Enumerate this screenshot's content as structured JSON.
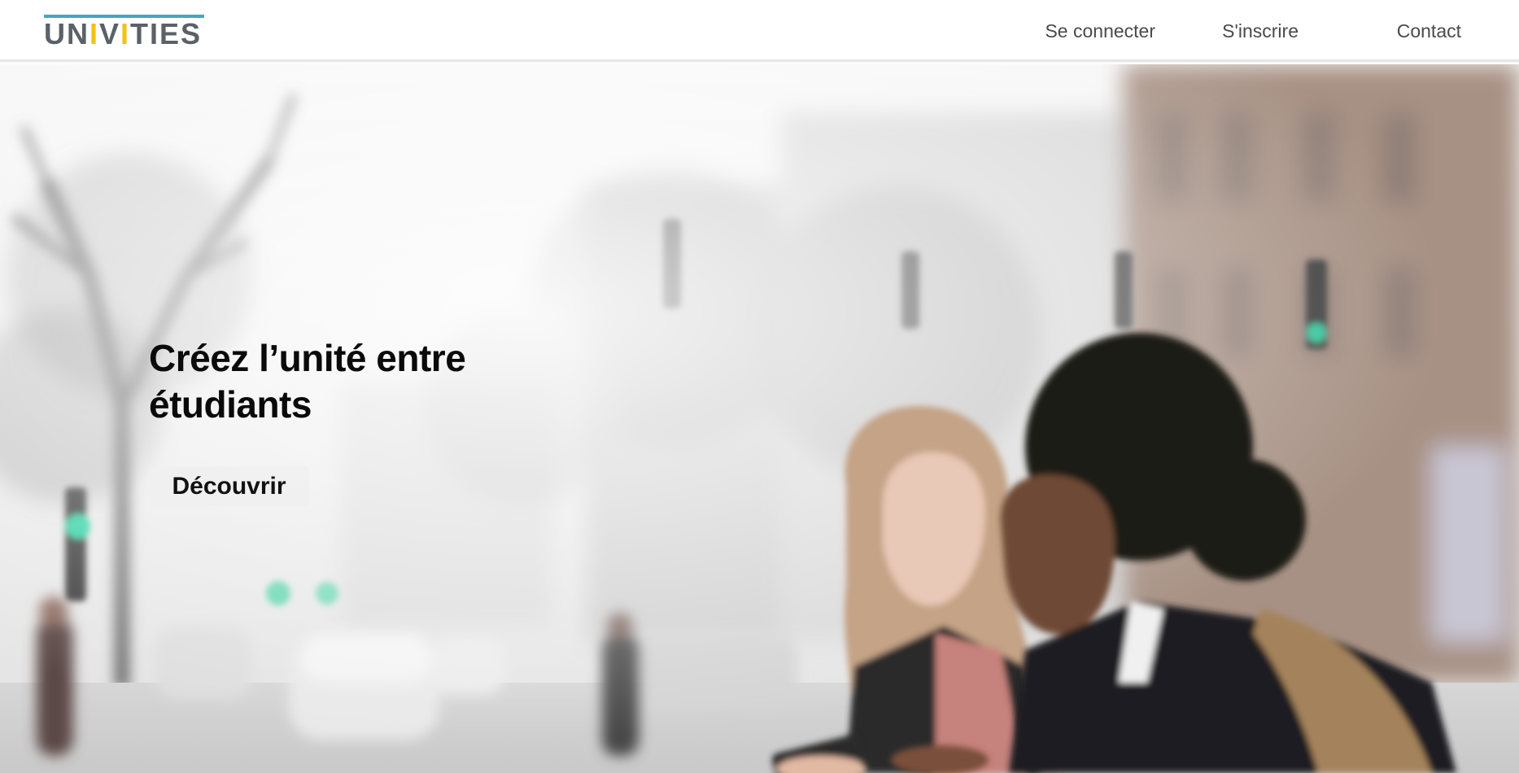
{
  "header": {
    "logo": {
      "prefix": "UN",
      "accent1": "I",
      "middle": "V",
      "accent2": "I",
      "suffix": "TIES",
      "bar_color": "#3fa7c6",
      "text_color": "#5b6168",
      "accent_color": "#f2c21a"
    },
    "nav": {
      "login": "Se connecter",
      "signup": "S'inscrire",
      "contact": "Contact"
    }
  },
  "hero": {
    "title_line1": "Créez l’unité entre",
    "title_line2": "étudiants",
    "cta_label": "Découvrir",
    "background_image": "street-scene-two-students-looking-at-phone"
  }
}
